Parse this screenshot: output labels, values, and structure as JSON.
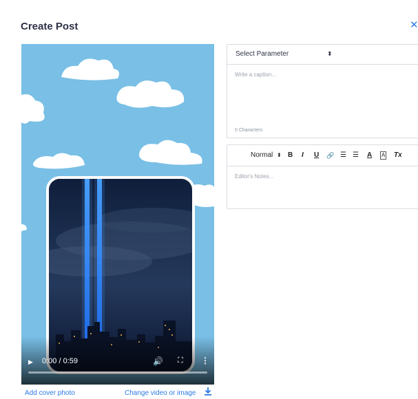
{
  "header": {
    "title": "Create Post",
    "close_label": "✕"
  },
  "video": {
    "time": "0:00 / 0:59",
    "progress": 0,
    "play_label": "▶",
    "volume_label": "🔊",
    "fullscreen_label": "⛶",
    "menu_label": "⋮"
  },
  "links": {
    "add_cover": "Add cover photo",
    "change_media": "Change video or image"
  },
  "form": {
    "select_value": "Select Parameter",
    "select_arrow": "⬍",
    "caption_placeholder": "Write a caption...",
    "char_count": "0 Characters",
    "notes_placeholder": "Editor's Notes..."
  },
  "toolbar": {
    "format_label": "Normal",
    "format_arrow": "⬍",
    "bold": "B",
    "italic": "I",
    "underline": "U",
    "link": "🔗",
    "ordered_list": "☰",
    "bullet_list": "☰",
    "font_color": "A",
    "highlight": "A",
    "clear_format": "Tx"
  },
  "icons": [
    "close-icon",
    "play-icon",
    "volume-icon",
    "fullscreen-icon",
    "menu-dots-icon",
    "download-icon",
    "link-icon",
    "ordered-list-icon",
    "bullet-list-icon",
    "font-color-icon",
    "highlight-icon",
    "clear-format-icon"
  ],
  "colors": {
    "accent": "#2c7be5",
    "sky": "#79bfe6",
    "border": "#d8dbe1"
  }
}
